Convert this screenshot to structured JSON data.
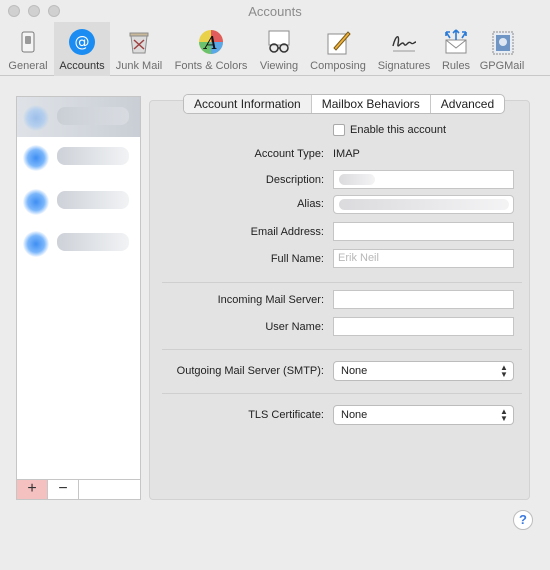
{
  "window": {
    "title": "Accounts"
  },
  "toolbar": {
    "items": [
      {
        "label": "General",
        "icon": "switch-icon"
      },
      {
        "label": "Accounts",
        "icon": "at-sign-icon"
      },
      {
        "label": "Junk Mail",
        "icon": "trash-bin-icon"
      },
      {
        "label": "Fonts & Colors",
        "icon": "color-font-icon"
      },
      {
        "label": "Viewing",
        "icon": "glasses-icon"
      },
      {
        "label": "Composing",
        "icon": "pencil-paper-icon"
      },
      {
        "label": "Signatures",
        "icon": "signature-icon"
      },
      {
        "label": "Rules",
        "icon": "envelope-arrows-icon"
      },
      {
        "label": "GPGMail",
        "icon": "stamp-icon"
      }
    ],
    "active": "Accounts"
  },
  "account_list": {
    "add_label": "+",
    "remove_label": "−"
  },
  "tabs": [
    "Account Information",
    "Mailbox Behaviors",
    "Advanced"
  ],
  "active_tab": "Account Information",
  "form": {
    "enable_label": "Enable this account",
    "account_type_label": "Account Type:",
    "account_type_value": "IMAP",
    "description_label": "Description:",
    "alias_label": "Alias:",
    "email_label": "Email Address:",
    "full_name_label": "Full Name:",
    "full_name_placeholder": "Erik Neil",
    "incoming_server_label": "Incoming Mail Server:",
    "user_name_label": "User Name:",
    "outgoing_server_label": "Outgoing Mail Server (SMTP):",
    "outgoing_server_value": "None",
    "tls_label": "TLS Certificate:",
    "tls_value": "None"
  },
  "help": {
    "label": "?"
  }
}
